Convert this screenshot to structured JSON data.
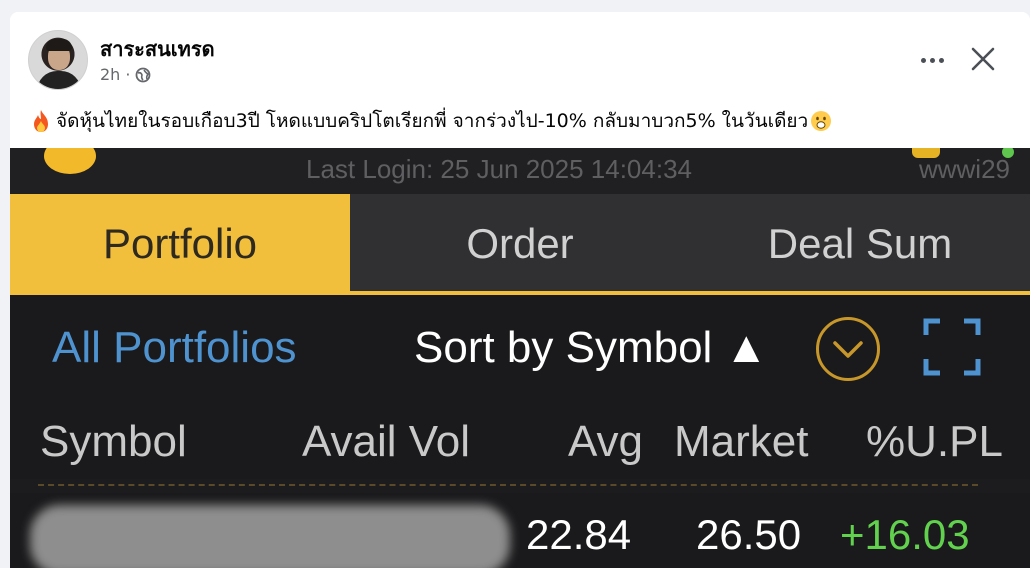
{
  "post": {
    "author": "สาระสนเทรด",
    "time": "2h",
    "separator": "·",
    "privacy_icon": "globe-icon",
    "text": "จัดหุ้นไทยในรอบเกือบ3ปี โหดแบบคริปโตเรียกพี่ จากร่วงไป-10% กลับมาบวก5% ในวันเดียว",
    "leading_emoji": "fire-icon",
    "trailing_emoji": "face-with-open-mouth-icon"
  },
  "screenshot": {
    "last_login": "Last Login: 25 Jun 2025 14:04:34",
    "user_id": "wwwi29",
    "tabs": [
      {
        "label": "Portfolio",
        "active": true
      },
      {
        "label": "Order",
        "active": false
      },
      {
        "label": "Deal Sum",
        "active": false
      }
    ],
    "filter_label": "All Portfolios",
    "sort_label": "Sort by Symbol ▲",
    "columns": [
      "Symbol",
      "Avail Vol",
      "Avg",
      "Market",
      "%U.PL"
    ],
    "row": {
      "avg": "22.84",
      "market": "26.50",
      "upl": "+16.03"
    },
    "colors": {
      "accent": "#f2bf3d",
      "link": "#4e93cf",
      "gain": "#61d14e"
    }
  }
}
